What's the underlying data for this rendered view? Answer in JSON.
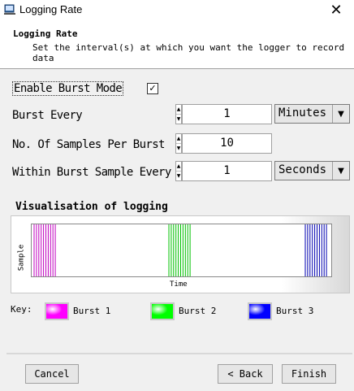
{
  "window": {
    "title": "Logging Rate"
  },
  "header": {
    "title": "Logging Rate",
    "subtitle": "Set the interval(s) at which you want the logger to record data"
  },
  "burst": {
    "enable_label": "Enable Burst Mode",
    "enabled": true,
    "checkbox_glyph": "✓",
    "every_label": "Burst Every",
    "every_value": "1",
    "every_unit": "Minutes",
    "samples_label": "No. Of Samples Per Burst",
    "samples_value": "10",
    "within_label": "Within Burst Sample Every",
    "within_value": "1",
    "within_unit": "Seconds"
  },
  "visualisation": {
    "title": "Visualisation of logging",
    "ylabel": "Sample",
    "xlabel": "Time",
    "bursts": [
      {
        "color": "#c000c0",
        "lines": 10
      },
      {
        "color": "#00c000",
        "lines": 10
      },
      {
        "color": "#0000b0",
        "lines": 10
      }
    ]
  },
  "key": {
    "label": "Key:",
    "items": [
      {
        "name": "Burst 1",
        "color": "#ff00ff"
      },
      {
        "name": "Burst 2",
        "color": "#00ff00"
      },
      {
        "name": "Burst 3",
        "color": "#0000ff"
      }
    ]
  },
  "buttons": {
    "cancel": "Cancel",
    "back": "< Back",
    "finish": "Finish"
  },
  "icons": {
    "close": "✕",
    "spin_up": "▲",
    "spin_down": "▼",
    "dropdown": "▼"
  }
}
